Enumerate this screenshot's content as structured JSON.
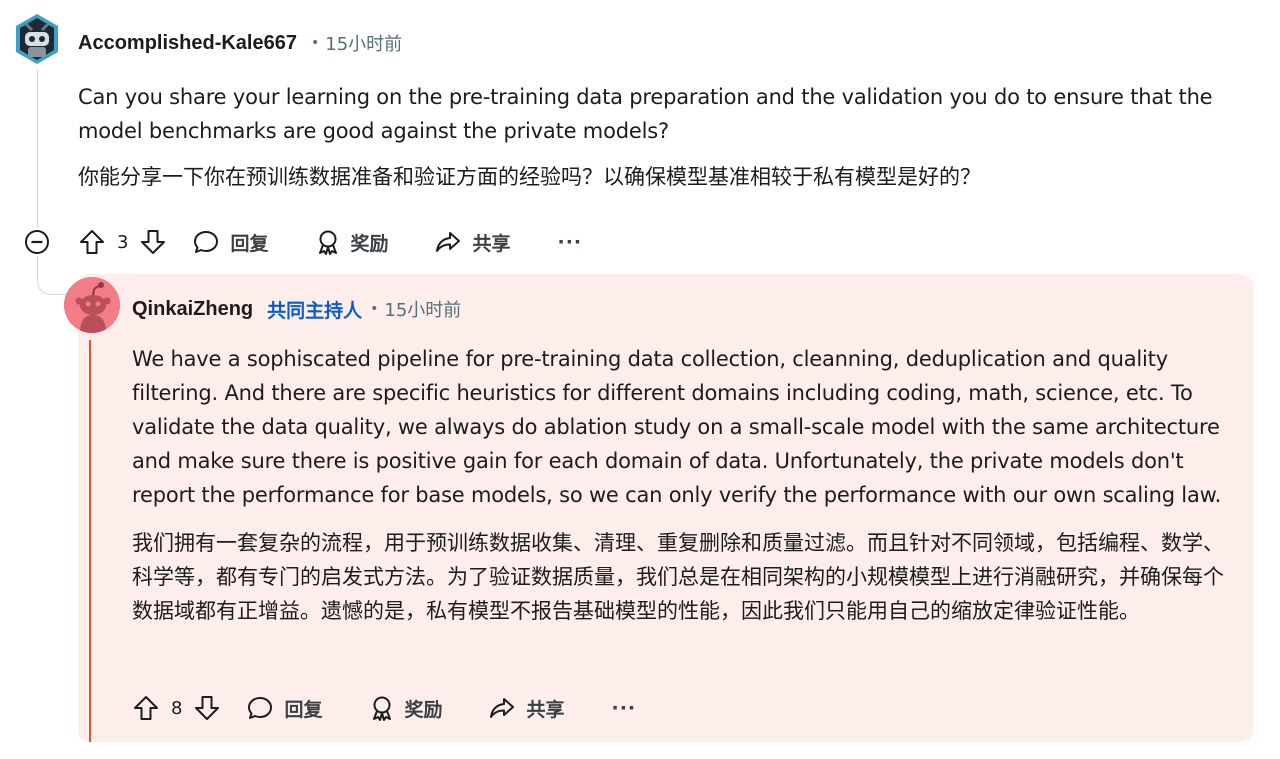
{
  "comment1": {
    "username": "Accomplished-Kale667",
    "separator": "•",
    "time": "15小时前",
    "body_en": "Can you share your learning on the pre-training data preparation and the validation you do to ensure that the model benchmarks are good against the private models?",
    "body_zh": "你能分享一下你在预训练数据准备和验证方面的经验吗？以确保模型基准相较于私有模型是好的？",
    "votes": "3",
    "reply_label": "回复",
    "award_label": "奖励",
    "share_label": "共享",
    "more_label": "···"
  },
  "comment2": {
    "username": "QinkaiZheng",
    "badge": "共同主持人",
    "separator": "•",
    "time": "15小时前",
    "body_en": "We have a sophiscated pipeline for pre-training data collection, cleanning, deduplication and quality filtering. And there are specific heuristics for different domains including coding, math, science, etc. To validate the data quality, we always do ablation study on a small-scale model with the same architecture and make sure there is positive gain for each domain of data. Unfortunately, the private models don't report the performance for base models, so we can only verify the performance with our own scaling law.",
    "body_zh": "我们拥有一套复杂的流程，用于预训练数据收集、清理、重复删除和质量过滤。而且针对不同领域，包括编程、数学、科学等，都有专门的启发式方法。为了验证数据质量，我们总是在相同架构的小规模模型上进行消融研究，并确保每个数据域都有正增益。遗憾的是，私有模型不报告基础模型的性能，因此我们只能用自己的缩放定律验证性能。",
    "votes": "8",
    "reply_label": "回复",
    "award_label": "奖励",
    "share_label": "共享",
    "more_label": "···"
  },
  "colors": {
    "highlight_bg": "#fdeeec",
    "thread_accent": "#e2542f",
    "mod_badge": "#0a5dc2",
    "meta": "#576f76"
  }
}
